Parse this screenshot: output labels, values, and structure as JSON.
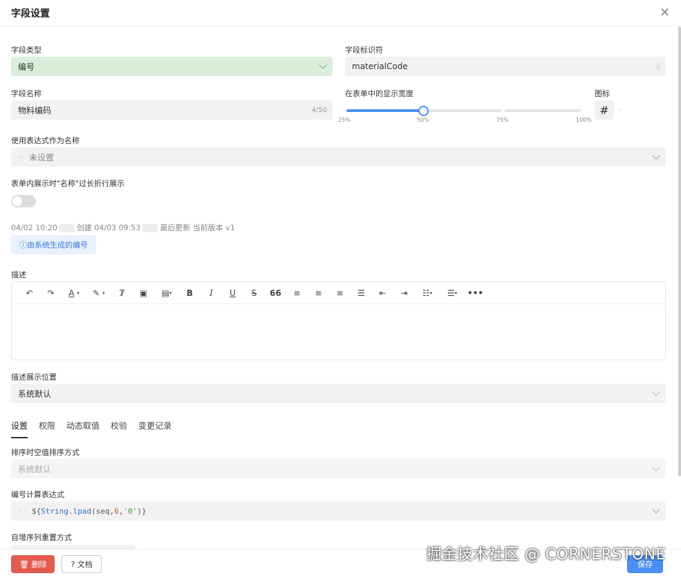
{
  "dialog": {
    "title": "字段设置"
  },
  "fields": {
    "type": {
      "label": "字段类型",
      "value": "编号"
    },
    "identifier": {
      "label": "字段标识符",
      "value": "materialCode"
    },
    "name": {
      "label": "字段名称",
      "value": "物料编码",
      "count": "4/50"
    },
    "width": {
      "label": "在表单中的显示宽度",
      "ticks": [
        "25%",
        "50%",
        "75%",
        "100%"
      ],
      "value_percent": 50
    },
    "icon": {
      "label": "图标",
      "glyph": "#"
    },
    "expr_name": {
      "label": "使用表达式作为名称",
      "value": "未设置"
    },
    "wrap": {
      "label": "表单内展示时\"名称\"过长折行展示",
      "on": false
    }
  },
  "meta": {
    "created_time": "04/02 10:20",
    "created_text": "创建",
    "updated_time": "04/03 09:53",
    "updated_text": "最后更新 当前版本 v1"
  },
  "system_button": {
    "label": "ⓘ由系统生成的编号"
  },
  "description": {
    "label": "描述"
  },
  "toolbar_icons": [
    "undo-icon",
    "redo-icon",
    "font-color-icon",
    "highlight-icon",
    "clear-format-icon",
    "image-icon",
    "table-icon",
    "bold-icon",
    "italic-icon",
    "underline-icon",
    "strikethrough-icon",
    "quote-icon",
    "align-left-icon",
    "align-center-icon",
    "align-right-icon",
    "justify-icon",
    "outdent-icon",
    "indent-icon",
    "ordered-list-icon",
    "bullet-list-icon",
    "more-icon"
  ],
  "desc_position": {
    "label": "描述展示位置",
    "value": "系统默认"
  },
  "tabs": [
    "设置",
    "权限",
    "动态取值",
    "校验",
    "变更记录"
  ],
  "sort_empty": {
    "label": "排序时空值排序方式",
    "value": "系统默认"
  },
  "expression": {
    "label": "编号计算表达式",
    "prefix": "${",
    "fn": "String.lpad",
    "args_open": "(seq,",
    "num": "6",
    "comma": ",",
    "str": "'0'",
    "close": ")}"
  },
  "reset": {
    "label": "自增序列重置方式"
  },
  "footer": {
    "delete": "🗑 删除",
    "docs": "? 文档",
    "save": "保存"
  },
  "watermark": "掘金技术社区 @ CORNERSTONE",
  "colors": {
    "accent": "#4a8ff7",
    "danger": "#e25b4f",
    "green_field": "#d9efd9"
  }
}
